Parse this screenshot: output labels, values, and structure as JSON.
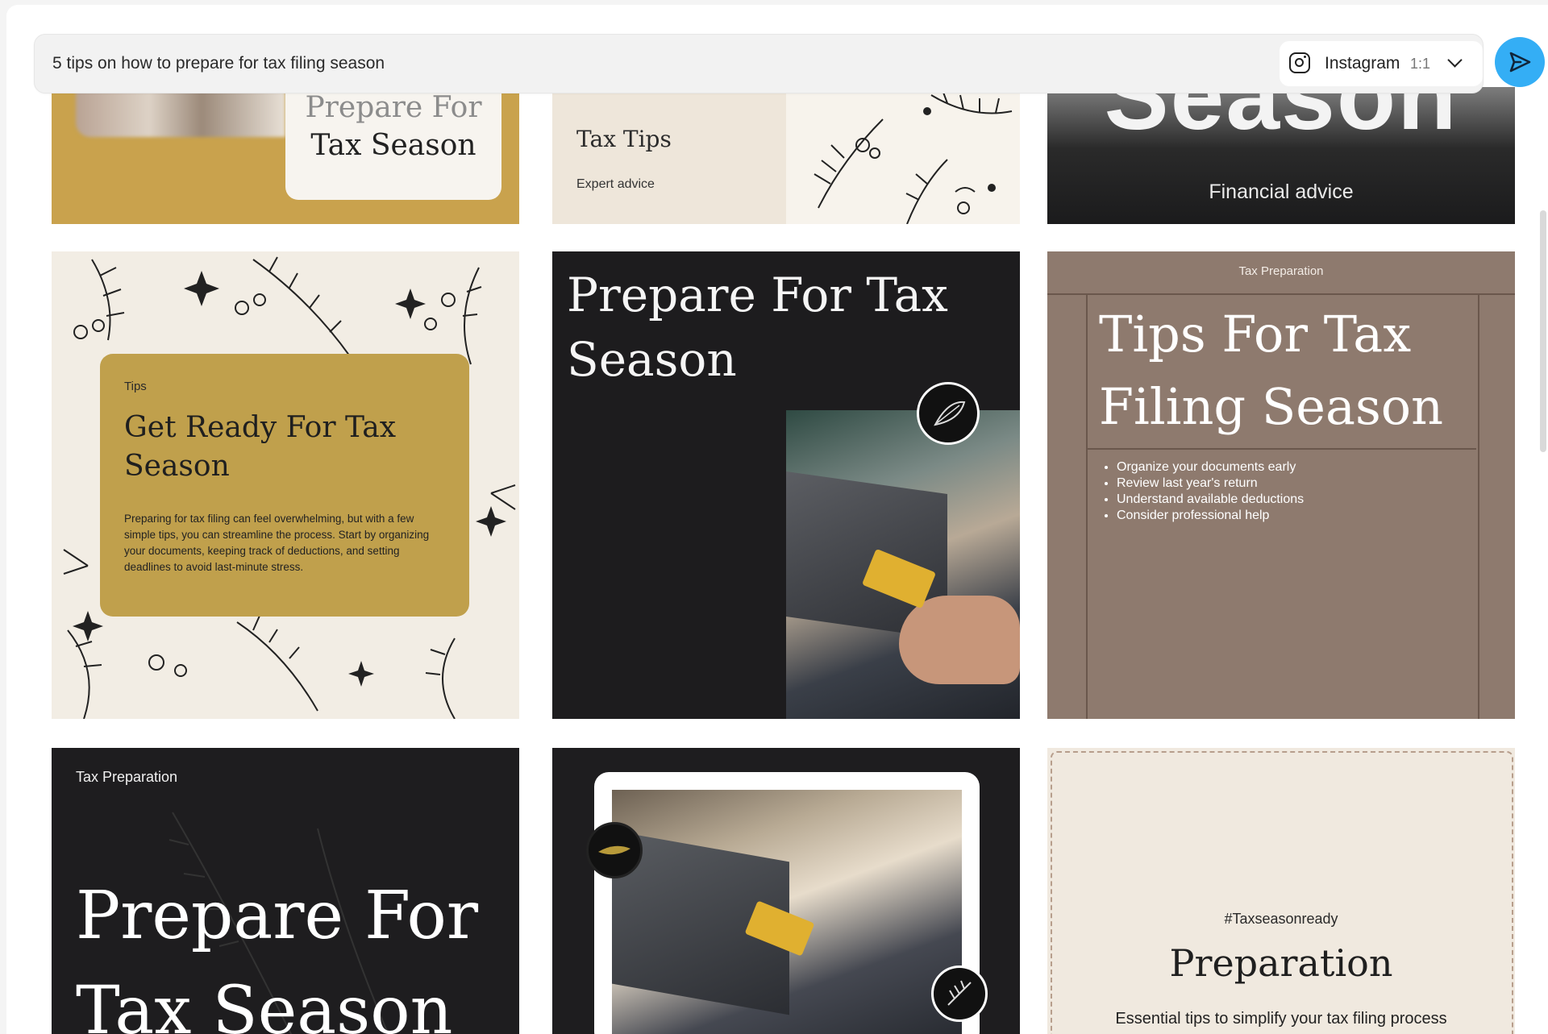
{
  "prompt": {
    "text": "5 tips on how to prepare for tax filing season",
    "format": {
      "platform": "Instagram",
      "ratio": "1:1"
    }
  },
  "designs": {
    "c1": {
      "line1": "Prepare For",
      "line2": "Tax Season"
    },
    "c2": {
      "heading": "Tax Tips",
      "subtitle": "Expert advice"
    },
    "c3": {
      "big_text": "Season",
      "subtitle": "Financial advice"
    },
    "c4": {
      "label": "Tips",
      "heading": "Get Ready For Tax Season",
      "body": "Preparing for tax filing can feel overwhelming, but with a few simple tips, you can streamline the process. Start by organizing your documents, keeping track of deductions, and setting deadlines to avoid last-minute stress."
    },
    "c5": {
      "heading": "Prepare For Tax Season"
    },
    "c6": {
      "label": "Tax Preparation",
      "heading": "Tips For Tax Filing Season",
      "bullets": [
        "Organize your documents early",
        "Review last year's return",
        "Understand available deductions",
        "Consider professional help"
      ]
    },
    "c7": {
      "label": "Tax Preparation",
      "heading": "Prepare For Tax Season"
    },
    "c9": {
      "tag": "#Taxseasonready",
      "heading": "Preparation",
      "body": "Essential tips to simplify your tax filing process"
    }
  },
  "colors": {
    "send_button": "#34aef5",
    "gold": "#c0a04c",
    "dark": "#1d1c1e",
    "taupe": "#8e7a6e",
    "cream": "#f2ede4"
  },
  "icons": [
    "instagram-icon",
    "chevron-down-icon",
    "send-icon",
    "leaf-badge-icon"
  ]
}
